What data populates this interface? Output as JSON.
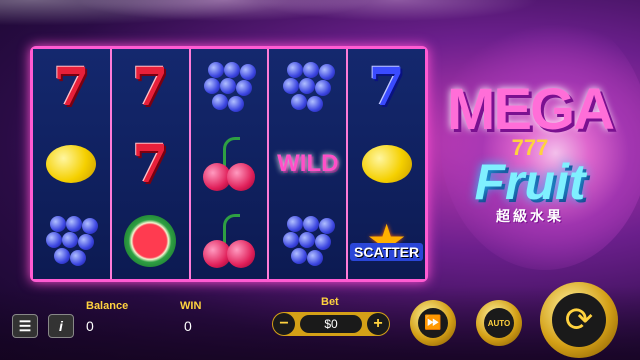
{
  "logo": {
    "mega": "MEGA",
    "sevens": "777",
    "fruit": "Fruit",
    "chinese": "超級水果"
  },
  "reels": [
    [
      "seven-red",
      "lemon",
      "grapes"
    ],
    [
      "seven-red",
      "seven-red",
      "watermelon"
    ],
    [
      "grapes",
      "cherries",
      "cherries"
    ],
    [
      "grapes",
      "wild",
      "grapes"
    ],
    [
      "seven-blue",
      "lemon",
      "scatter"
    ]
  ],
  "symbols": {
    "wild_label": "WILD",
    "scatter_label": "SCATTER"
  },
  "hud": {
    "menu_icon": "menu-icon",
    "info_label": "i",
    "balance_label": "Balance",
    "balance_value": "0",
    "win_label": "WIN",
    "win_value": "0",
    "bet_label": "Bet",
    "bet_value": "$0",
    "bet_minus": "−",
    "bet_plus": "+",
    "auto_label": "AUTO"
  },
  "colors": {
    "frame": "#ff5bd2",
    "gold": "#d4a017",
    "reel_bg": "#0f1f5a"
  }
}
